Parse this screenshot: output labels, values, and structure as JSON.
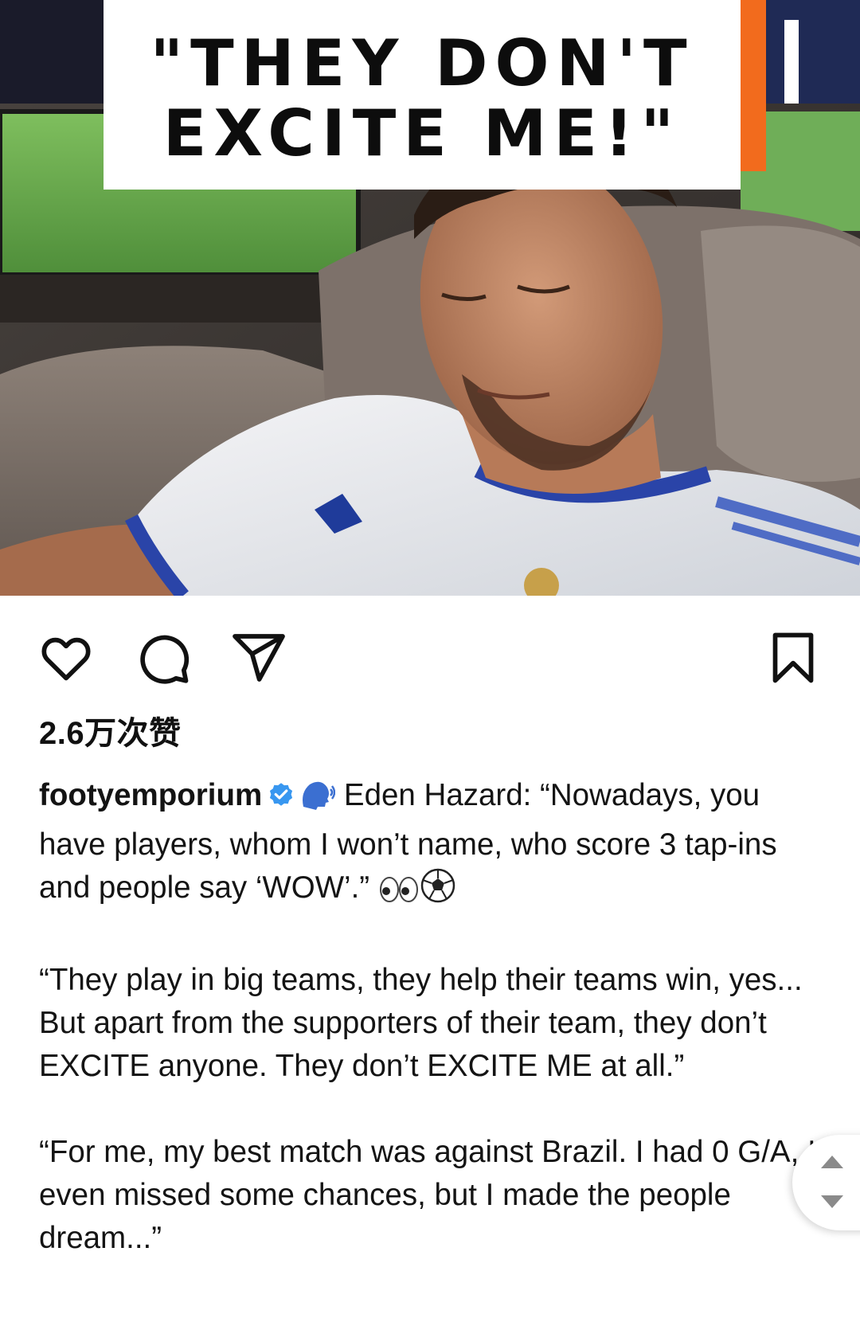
{
  "post": {
    "image": {
      "headline_line1": "\"THEY DON'T",
      "headline_line2": "EXCITE ME!\"",
      "accent_color": "#f26b1d"
    },
    "actions": {
      "like_icon": "heart-icon",
      "comment_icon": "comment-icon",
      "share_icon": "send-icon",
      "save_icon": "bookmark-icon"
    },
    "likes_text": "2.6万次赞",
    "caption": {
      "username": "footyemporium",
      "verified_color": "#3897f0",
      "line1_emoji": "speaking-head-emoji",
      "paragraph1": "Eden Hazard: “Nowadays, you have players, whom I won’t name, who score 3 tap-ins and people say ‘WOW’.”",
      "paragraph1_emoji": "eyes-emoji soccer-ball-emoji",
      "paragraph2": "“They play in big teams, they help their teams win, yes... But apart from the supporters of their team, they don’t EXCITE anyone. They don’t EXCITE ME at all.”",
      "paragraph3": "“For me, my best match was against Brazil. I had 0 G/A, I even missed some chances, but I made the people dream...”"
    }
  },
  "scroll_widget": {
    "up_icon": "arrow-up-icon",
    "down_icon": "arrow-down-icon"
  }
}
